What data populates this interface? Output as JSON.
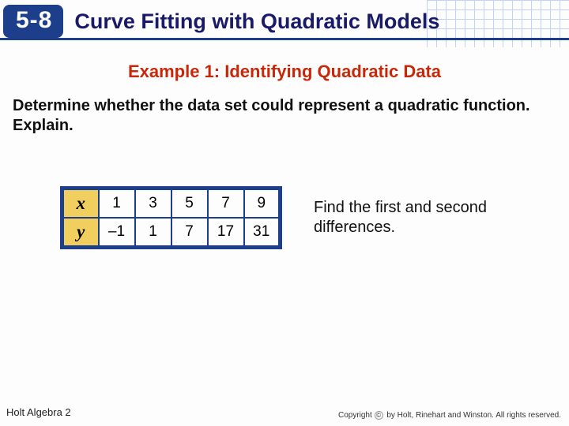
{
  "header": {
    "section_number": "5-8",
    "title": "Curve Fitting with Quadratic Models"
  },
  "example": {
    "label": "Example 1: Identifying Quadratic Data",
    "prompt": "Determine whether the data set could represent a quadratic function. Explain."
  },
  "table": {
    "row_labels": [
      "x",
      "y"
    ],
    "rows": [
      [
        "1",
        "3",
        "5",
        "7",
        "9"
      ],
      [
        "–1",
        "1",
        "7",
        "17",
        "31"
      ]
    ]
  },
  "instruction": "Find the first and second differences.",
  "footer": {
    "left": "Holt Algebra 2",
    "right": "by Holt, Rinehart and Winston. All rights reserved.",
    "copyright_word": "Copyright"
  }
}
